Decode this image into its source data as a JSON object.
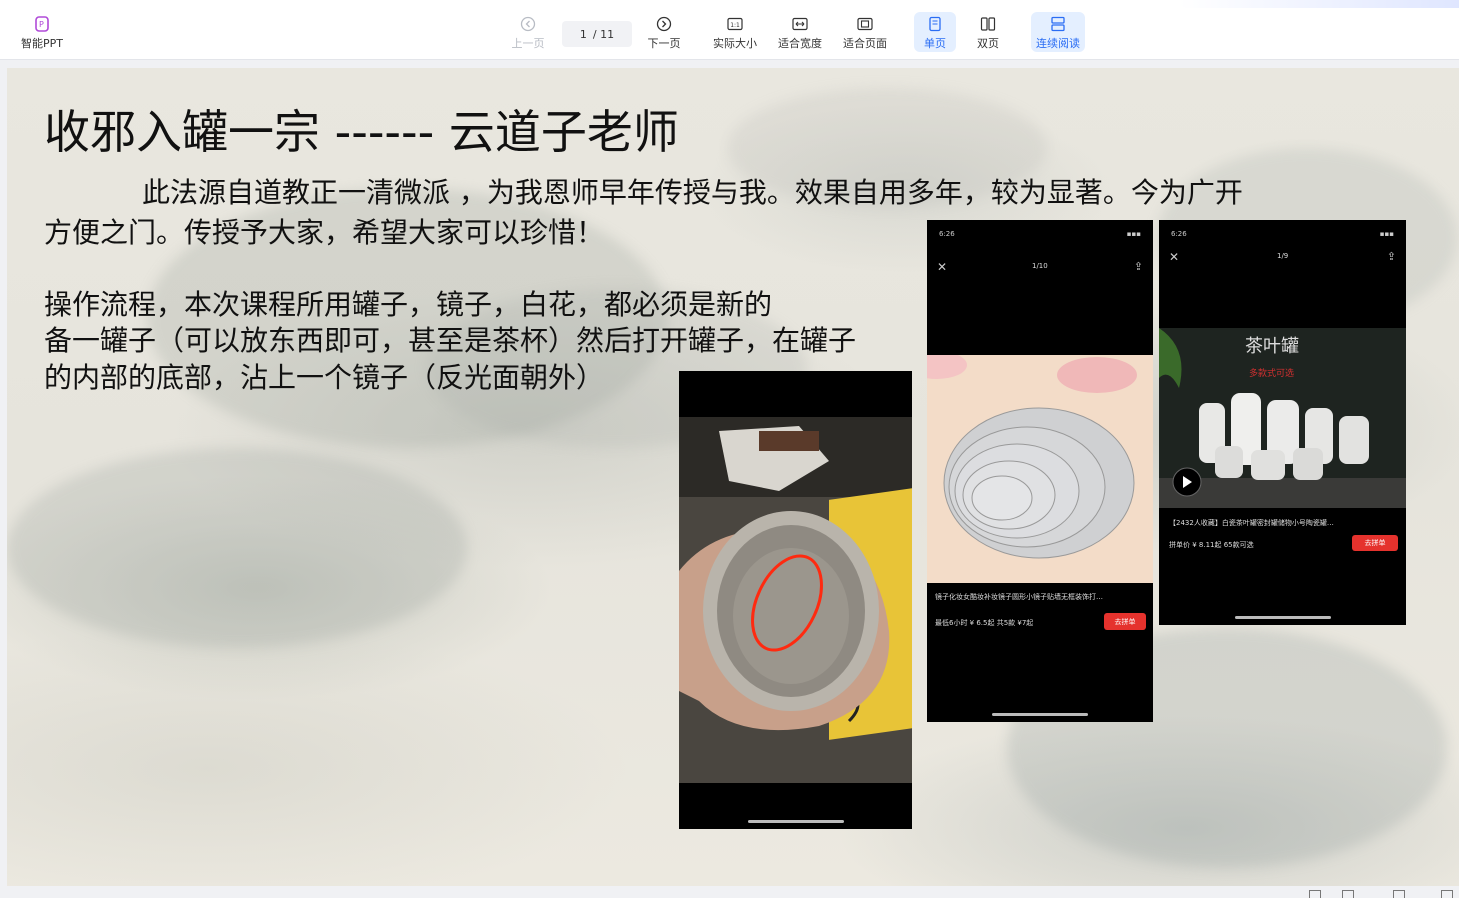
{
  "app": {
    "logo_label": "智能PPT"
  },
  "toolbar": {
    "prev_label": "上一页",
    "page_current": "1",
    "page_total": "/ 11",
    "next_label": "下一页",
    "actual_size_label": "实际大小",
    "fit_width_label": "适合宽度",
    "fit_page_label": "适合页面",
    "single_page_label": "单页",
    "double_page_label": "双页",
    "continuous_label": "连续阅读",
    "actual_size_icon_text": "1:1"
  },
  "slide": {
    "title": "收邪入罐一宗 ------ 云道子老师",
    "intro_line1": "此法源自道教正一清微派 ，为我恩师早年传授与我。效果自用多年，较为显著。今为广开",
    "intro_line2": "方便之门。传授予大家，希望大家可以珍惜！",
    "steps_line1": "操作流程，本次课程所用罐子，镜子，白花，都必须是新的",
    "steps_line2": "备一罐子（可以放东西即可，甚至是茶杯）然后打开罐子，在罐子",
    "steps_line3": "的内部的底部，沾上一个镜子（反光面朝外）"
  },
  "photo_mirror": {
    "time": "6:26",
    "counter": "1/10",
    "desc": "镜子化妆女酷妆补妆镜子圆形小镜子贴墙无框装饰打…",
    "price_line": "最低6小时 ¥ 6.5起  共5款 ¥7起",
    "buy_label": "去拼单"
  },
  "photo_jar": {
    "time": "6:26",
    "counter": "1/9",
    "banner_title": "茶叶罐",
    "banner_sub": "多款式可选",
    "desc": "【2432人收藏】白瓷茶叶罐密封罐储物小号陶瓷罐…",
    "price_line": "拼单价 ¥ 8.11起  65款可选",
    "buy_label": "去拼单"
  }
}
